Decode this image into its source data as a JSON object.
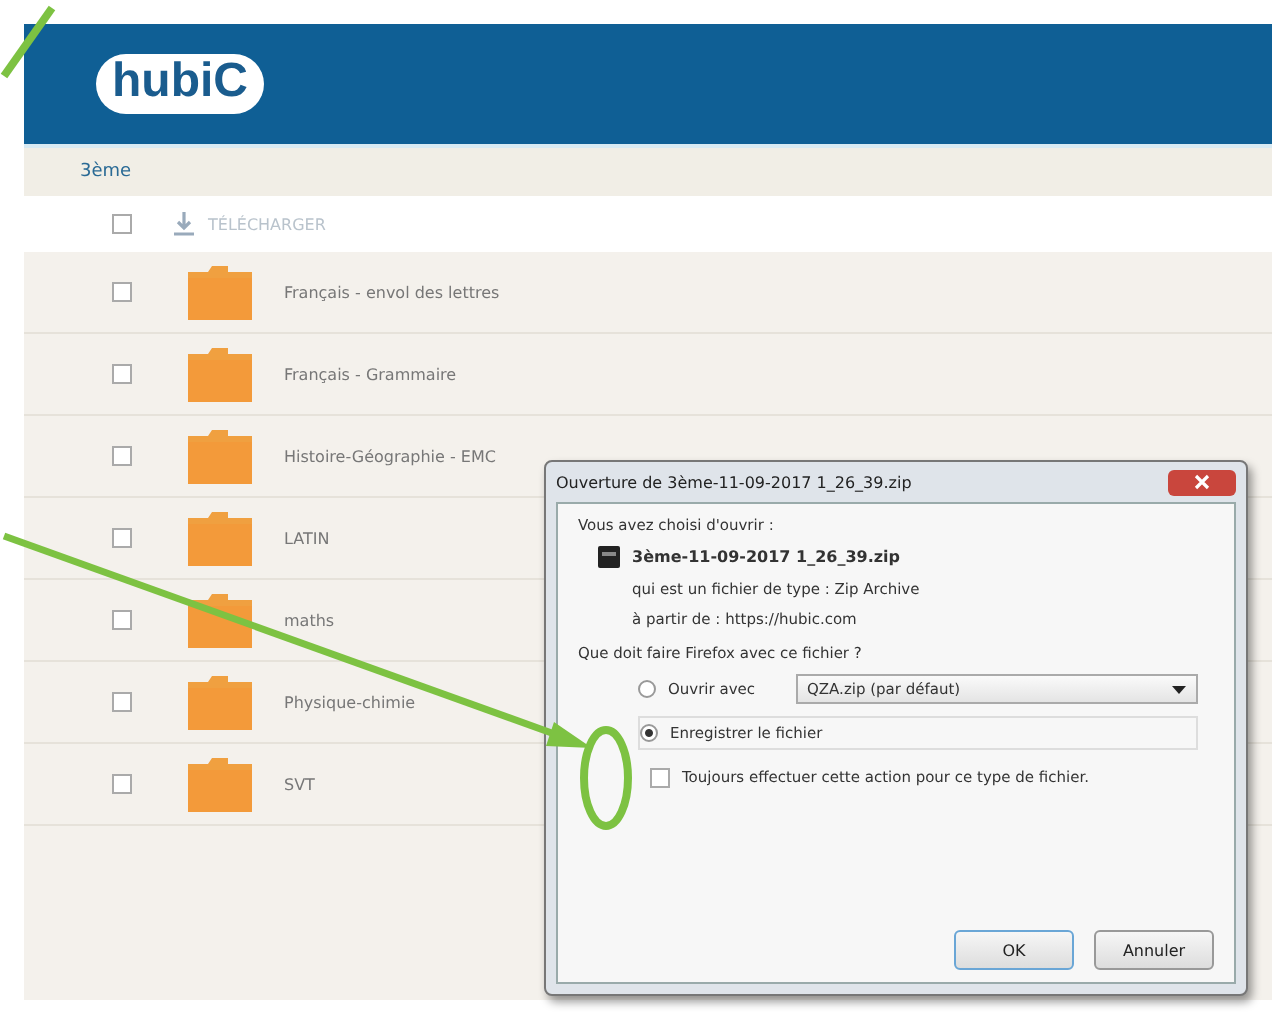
{
  "header": {
    "logo": "hubiC"
  },
  "breadcrumb": "3ème",
  "toolbar": {
    "select_all_checked": false,
    "download_label": "TÉLÉCHARGER"
  },
  "folders": [
    {
      "name": "Français - envol des lettres",
      "checked": false
    },
    {
      "name": "Français - Grammaire",
      "checked": false
    },
    {
      "name": "Histoire-Géographie - EMC",
      "checked": false
    },
    {
      "name": "LATIN",
      "checked": false
    },
    {
      "name": "maths",
      "checked": false
    },
    {
      "name": "Physique-chimie",
      "checked": false
    },
    {
      "name": "SVT",
      "checked": false
    }
  ],
  "dialog": {
    "title": "Ouverture de 3ème-11-09-2017 1_26_39.zip",
    "intro": "Vous avez choisi d'ouvrir :",
    "file_name": "3ème-11-09-2017 1_26_39.zip",
    "file_type": "qui est un fichier de type : Zip Archive",
    "source": "à partir de : https://hubic.com",
    "question": "Que doit faire Firefox avec ce fichier ?",
    "options": [
      {
        "label": "Ouvrir avec",
        "selected": false,
        "app": "QZA.zip (par défaut)"
      },
      {
        "label": "Enregistrer le fichier",
        "selected": true
      }
    ],
    "always": {
      "label": "Toujours effectuer cette action pour ce type de fichier.",
      "checked": false
    },
    "buttons": [
      "OK",
      "Annuler"
    ]
  }
}
